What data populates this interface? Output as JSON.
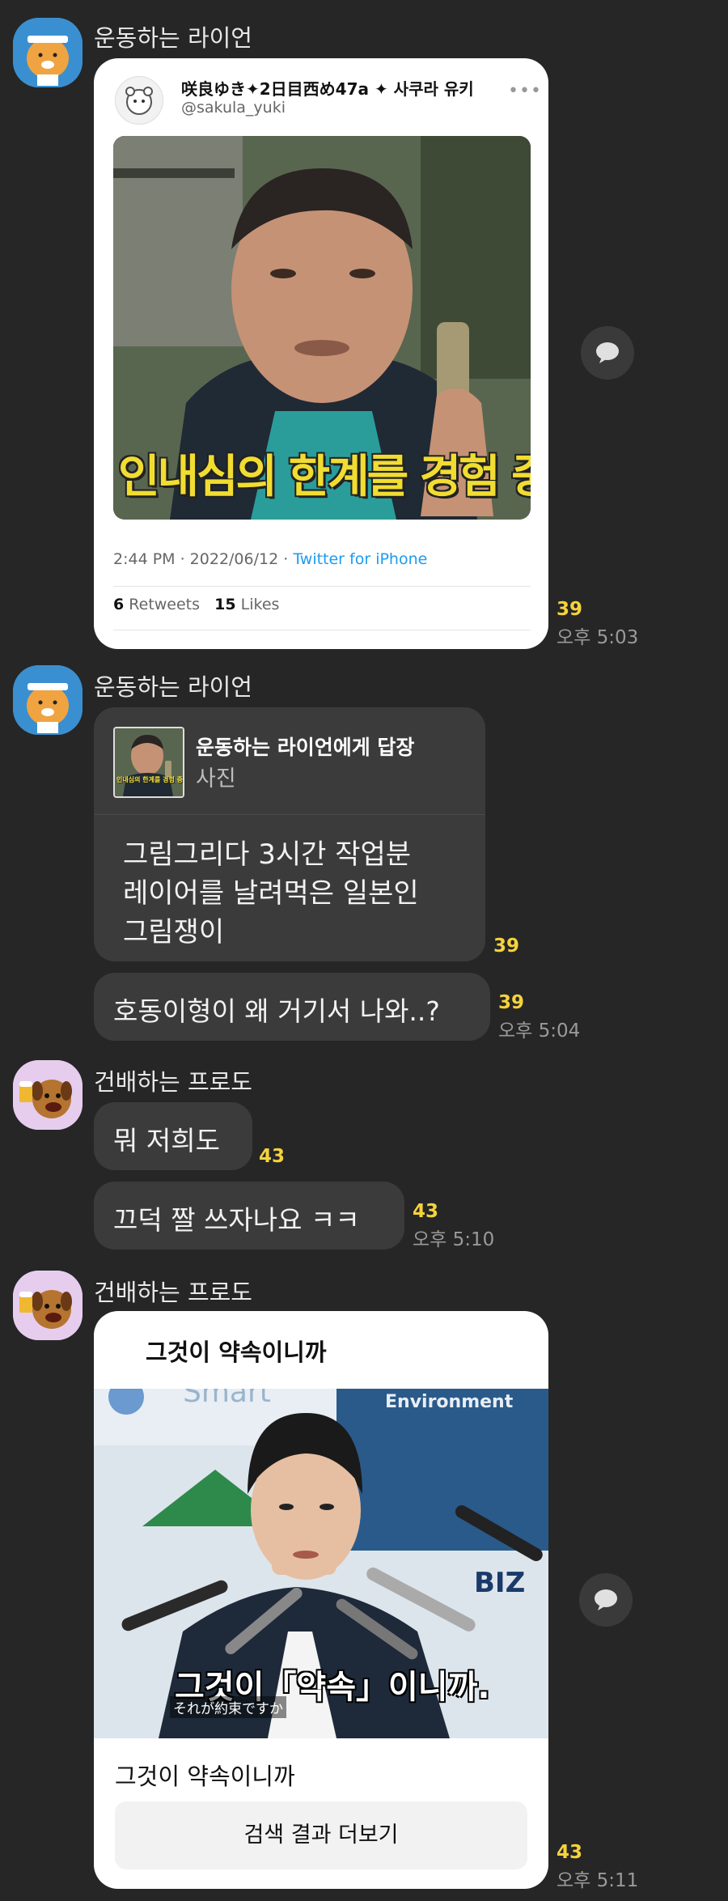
{
  "messages": {
    "m1": {
      "sender": "운동하는 라이언",
      "tweet": {
        "author": "咲良ゆき✦2日目西め47a ✦ 사쿠라 유키",
        "handle": "@sakula_yuki",
        "image_caption": "인내심의 한계를 경험 중",
        "timestamp": "2:44 PM · 2022/06/12 · ",
        "client": "Twitter for iPhone",
        "retweets_count": "6",
        "retweets_label": "Retweets",
        "likes_count": "15",
        "likes_label": "Likes"
      },
      "unread": "39",
      "time": "오후 5:03"
    },
    "m2": {
      "sender": "운동하는 라이언",
      "reply_title": "운동하는 라이언에게 답장",
      "reply_sub": "사진",
      "reply_thumb_caption": "인내심의 한계를 경험 중",
      "text_line1": "그림그리다 3시간 작업분",
      "text_line2": "레이어를 날려먹은 일본인",
      "text_line3": "그림쟁이",
      "unread": "39"
    },
    "m3": {
      "text": "호동이형이 왜 거기서 나와..?",
      "unread": "39",
      "time": "오후 5:04"
    },
    "m4": {
      "sender": "건배하는 프로도",
      "text": "뭐 저희도",
      "unread": "43"
    },
    "m5": {
      "text": "끄덕 짤 쓰자나요 ㅋㅋ",
      "unread": "43",
      "time": "오후 5:10"
    },
    "m6": {
      "sender": "건배하는 프로도",
      "card_title": "그것이 약속이니까",
      "bg_text_1": "Environment",
      "bg_text_2": "Smart",
      "bg_text_3": "BIZ",
      "video_subtitle": "그것이「약속」이니까.",
      "video_subtitle_jp": "それが約束ですか",
      "caption": "그것이 약속이니까",
      "more_button": "검색 결과 더보기",
      "unread": "43",
      "time": "오후 5:11"
    }
  },
  "icons": {
    "share": "share-speech-bubble-icon",
    "more": "more-dots-icon"
  },
  "colors": {
    "background": "#262626",
    "bubble": "#3b3b3b",
    "unread": "#f5d33c",
    "twitter_link": "#1d9bf0"
  }
}
